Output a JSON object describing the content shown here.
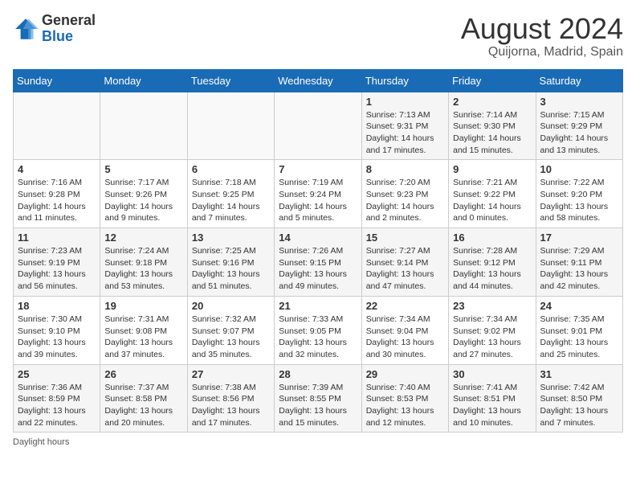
{
  "header": {
    "logo_general": "General",
    "logo_blue": "Blue",
    "month_year": "August 2024",
    "location": "Quijorna, Madrid, Spain"
  },
  "footer": {
    "note": "Daylight hours"
  },
  "weekdays": [
    "Sunday",
    "Monday",
    "Tuesday",
    "Wednesday",
    "Thursday",
    "Friday",
    "Saturday"
  ],
  "weeks": [
    [
      {
        "day": "",
        "info": ""
      },
      {
        "day": "",
        "info": ""
      },
      {
        "day": "",
        "info": ""
      },
      {
        "day": "",
        "info": ""
      },
      {
        "day": "1",
        "info": "Sunrise: 7:13 AM\nSunset: 9:31 PM\nDaylight: 14 hours\nand 17 minutes."
      },
      {
        "day": "2",
        "info": "Sunrise: 7:14 AM\nSunset: 9:30 PM\nDaylight: 14 hours\nand 15 minutes."
      },
      {
        "day": "3",
        "info": "Sunrise: 7:15 AM\nSunset: 9:29 PM\nDaylight: 14 hours\nand 13 minutes."
      }
    ],
    [
      {
        "day": "4",
        "info": "Sunrise: 7:16 AM\nSunset: 9:28 PM\nDaylight: 14 hours\nand 11 minutes."
      },
      {
        "day": "5",
        "info": "Sunrise: 7:17 AM\nSunset: 9:26 PM\nDaylight: 14 hours\nand 9 minutes."
      },
      {
        "day": "6",
        "info": "Sunrise: 7:18 AM\nSunset: 9:25 PM\nDaylight: 14 hours\nand 7 minutes."
      },
      {
        "day": "7",
        "info": "Sunrise: 7:19 AM\nSunset: 9:24 PM\nDaylight: 14 hours\nand 5 minutes."
      },
      {
        "day": "8",
        "info": "Sunrise: 7:20 AM\nSunset: 9:23 PM\nDaylight: 14 hours\nand 2 minutes."
      },
      {
        "day": "9",
        "info": "Sunrise: 7:21 AM\nSunset: 9:22 PM\nDaylight: 14 hours\nand 0 minutes."
      },
      {
        "day": "10",
        "info": "Sunrise: 7:22 AM\nSunset: 9:20 PM\nDaylight: 13 hours\nand 58 minutes."
      }
    ],
    [
      {
        "day": "11",
        "info": "Sunrise: 7:23 AM\nSunset: 9:19 PM\nDaylight: 13 hours\nand 56 minutes."
      },
      {
        "day": "12",
        "info": "Sunrise: 7:24 AM\nSunset: 9:18 PM\nDaylight: 13 hours\nand 53 minutes."
      },
      {
        "day": "13",
        "info": "Sunrise: 7:25 AM\nSunset: 9:16 PM\nDaylight: 13 hours\nand 51 minutes."
      },
      {
        "day": "14",
        "info": "Sunrise: 7:26 AM\nSunset: 9:15 PM\nDaylight: 13 hours\nand 49 minutes."
      },
      {
        "day": "15",
        "info": "Sunrise: 7:27 AM\nSunset: 9:14 PM\nDaylight: 13 hours\nand 47 minutes."
      },
      {
        "day": "16",
        "info": "Sunrise: 7:28 AM\nSunset: 9:12 PM\nDaylight: 13 hours\nand 44 minutes."
      },
      {
        "day": "17",
        "info": "Sunrise: 7:29 AM\nSunset: 9:11 PM\nDaylight: 13 hours\nand 42 minutes."
      }
    ],
    [
      {
        "day": "18",
        "info": "Sunrise: 7:30 AM\nSunset: 9:10 PM\nDaylight: 13 hours\nand 39 minutes."
      },
      {
        "day": "19",
        "info": "Sunrise: 7:31 AM\nSunset: 9:08 PM\nDaylight: 13 hours\nand 37 minutes."
      },
      {
        "day": "20",
        "info": "Sunrise: 7:32 AM\nSunset: 9:07 PM\nDaylight: 13 hours\nand 35 minutes."
      },
      {
        "day": "21",
        "info": "Sunrise: 7:33 AM\nSunset: 9:05 PM\nDaylight: 13 hours\nand 32 minutes."
      },
      {
        "day": "22",
        "info": "Sunrise: 7:34 AM\nSunset: 9:04 PM\nDaylight: 13 hours\nand 30 minutes."
      },
      {
        "day": "23",
        "info": "Sunrise: 7:34 AM\nSunset: 9:02 PM\nDaylight: 13 hours\nand 27 minutes."
      },
      {
        "day": "24",
        "info": "Sunrise: 7:35 AM\nSunset: 9:01 PM\nDaylight: 13 hours\nand 25 minutes."
      }
    ],
    [
      {
        "day": "25",
        "info": "Sunrise: 7:36 AM\nSunset: 8:59 PM\nDaylight: 13 hours\nand 22 minutes."
      },
      {
        "day": "26",
        "info": "Sunrise: 7:37 AM\nSunset: 8:58 PM\nDaylight: 13 hours\nand 20 minutes."
      },
      {
        "day": "27",
        "info": "Sunrise: 7:38 AM\nSunset: 8:56 PM\nDaylight: 13 hours\nand 17 minutes."
      },
      {
        "day": "28",
        "info": "Sunrise: 7:39 AM\nSunset: 8:55 PM\nDaylight: 13 hours\nand 15 minutes."
      },
      {
        "day": "29",
        "info": "Sunrise: 7:40 AM\nSunset: 8:53 PM\nDaylight: 13 hours\nand 12 minutes."
      },
      {
        "day": "30",
        "info": "Sunrise: 7:41 AM\nSunset: 8:51 PM\nDaylight: 13 hours\nand 10 minutes."
      },
      {
        "day": "31",
        "info": "Sunrise: 7:42 AM\nSunset: 8:50 PM\nDaylight: 13 hours\nand 7 minutes."
      }
    ]
  ]
}
